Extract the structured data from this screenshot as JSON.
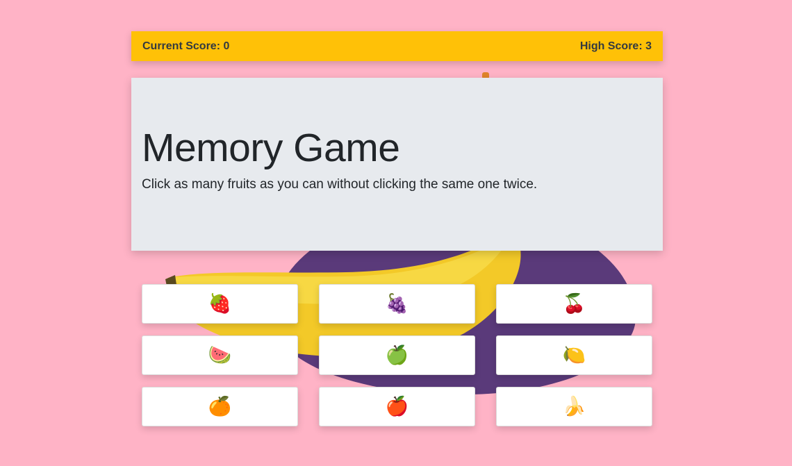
{
  "scores": {
    "current_label": "Current Score: 0",
    "high_label": "High Score: 3"
  },
  "hero": {
    "title": "Memory Game",
    "subtitle": "Click as many fruits as you can without clicking the same one twice."
  },
  "fruits": [
    {
      "name": "strawberry",
      "glyph": "🍓"
    },
    {
      "name": "grapes",
      "glyph": "🍇"
    },
    {
      "name": "cherries",
      "glyph": "🍒"
    },
    {
      "name": "watermelon",
      "glyph": "🍉"
    },
    {
      "name": "green-apple",
      "glyph": "🍏"
    },
    {
      "name": "lemon",
      "glyph": "🍋"
    },
    {
      "name": "tangerine",
      "glyph": "🍊"
    },
    {
      "name": "red-apple",
      "glyph": "🍎"
    },
    {
      "name": "banana",
      "glyph": "🍌"
    }
  ],
  "colors": {
    "page_background": "#ffb3c6",
    "topbar": "#ffc107",
    "jumbotron": "#e7eaee",
    "card": "#ffffff",
    "plate": "#5a3a7a",
    "banana": "#f3c928"
  }
}
